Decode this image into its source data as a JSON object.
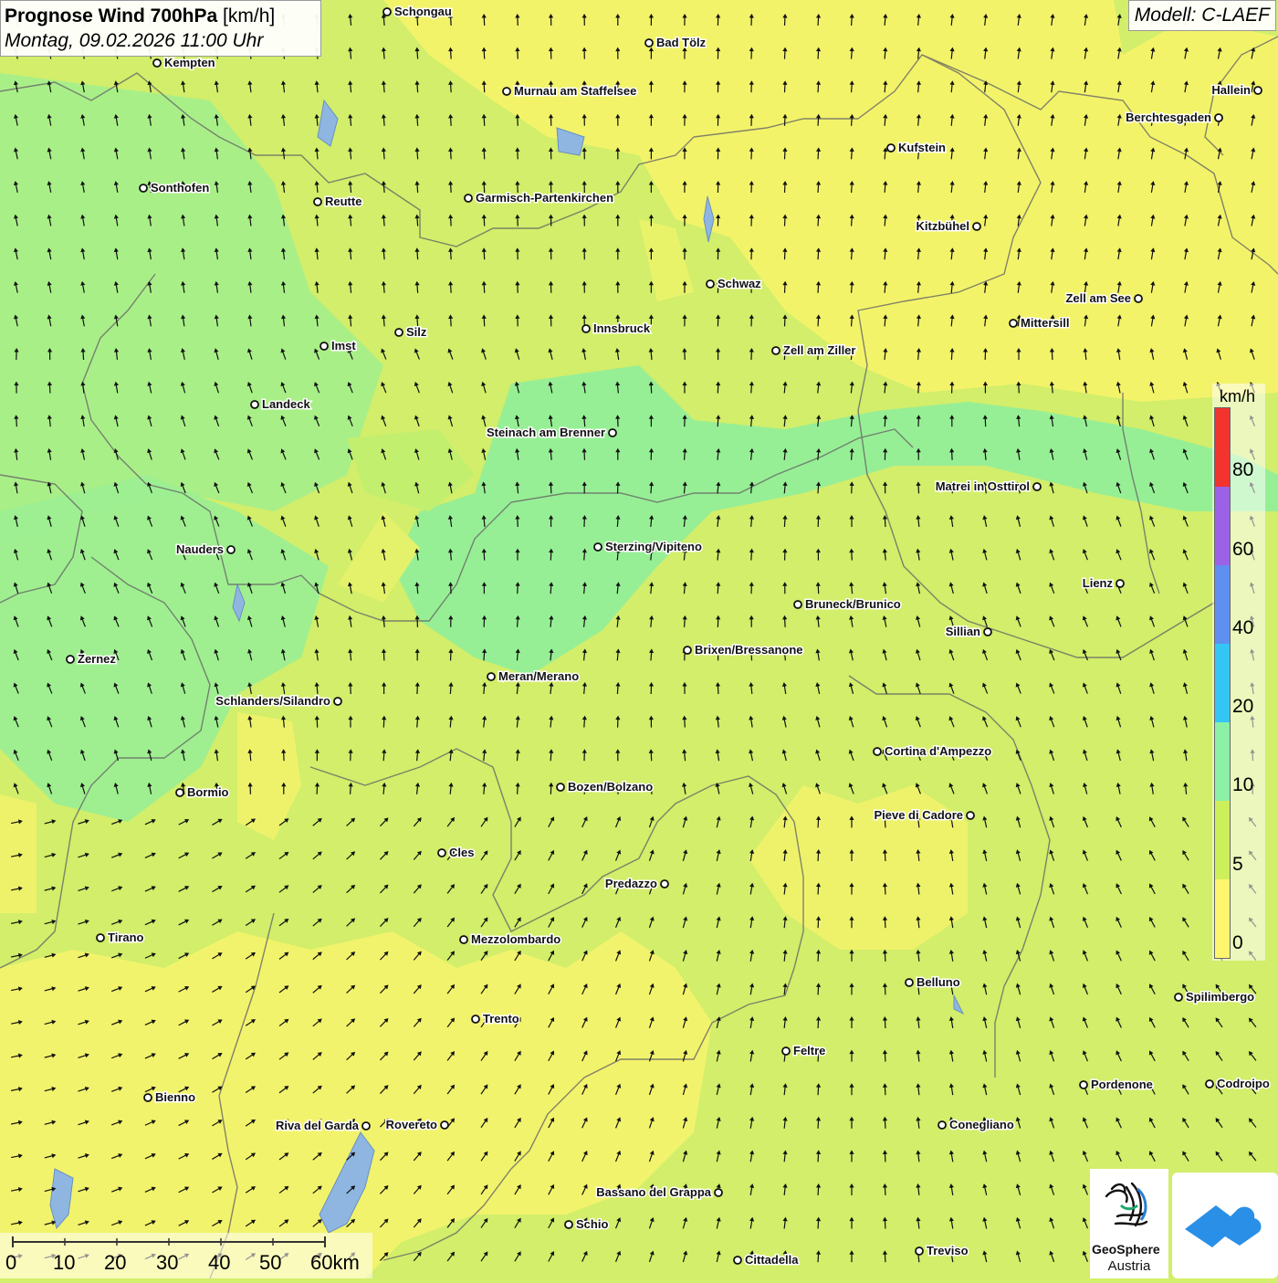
{
  "header": {
    "title_bold": "Prognose Wind 700hPa",
    "title_unit": "[km/h]",
    "datetime": "Montag, 09.02.2026 11:00 Uhr"
  },
  "model": {
    "label": "Modell: C-LAEF"
  },
  "legend": {
    "unit": "km/h",
    "levels": [
      {
        "label": "80",
        "color": "#f2332e"
      },
      {
        "label": "60",
        "color": "#9b62e8"
      },
      {
        "label": "40",
        "color": "#5f8ff0"
      },
      {
        "label": "20",
        "color": "#33c6f5"
      },
      {
        "label": "10",
        "color": "#8cf0a6"
      },
      {
        "label": "5",
        "color": "#cdf05a"
      },
      {
        "label": "0",
        "color": "#fff56e"
      }
    ]
  },
  "scalebar": {
    "labels": [
      "0",
      "10",
      "20",
      "30",
      "40",
      "50",
      "60km"
    ]
  },
  "logos": {
    "geosphere_line1": "GeoSphere",
    "geosphere_line2": "Austria"
  },
  "cities": [
    {
      "name": "Schongau"
    },
    {
      "name": "Bad Tölz"
    },
    {
      "name": "Kempten"
    },
    {
      "name": "Murnau am Staffelsee"
    },
    {
      "name": "Hallein"
    },
    {
      "name": "Berchtesgaden"
    },
    {
      "name": "Kufstein"
    },
    {
      "name": "Sonthofen"
    },
    {
      "name": "Reutte"
    },
    {
      "name": "Garmisch-Partenkirchen"
    },
    {
      "name": "Kitzbühel"
    },
    {
      "name": "Schwaz"
    },
    {
      "name": "Zell am See"
    },
    {
      "name": "Mittersill"
    },
    {
      "name": "Silz"
    },
    {
      "name": "Innsbruck"
    },
    {
      "name": "Imst"
    },
    {
      "name": "Zell am Ziller"
    },
    {
      "name": "Landeck"
    },
    {
      "name": "Steinach am Brenner"
    },
    {
      "name": "Matrei in Osttirol"
    },
    {
      "name": "Nauders"
    },
    {
      "name": "Sterzing/Vipiteno"
    },
    {
      "name": "Lienz"
    },
    {
      "name": "Bruneck/Brunico"
    },
    {
      "name": "Sillian"
    },
    {
      "name": "Zernez"
    },
    {
      "name": "Brixen/Bressanone"
    },
    {
      "name": "Meran/Merano"
    },
    {
      "name": "Schlanders/Silandro"
    },
    {
      "name": "Cortina d'Ampezzo"
    },
    {
      "name": "Bozen/Bolzano"
    },
    {
      "name": "Bormio"
    },
    {
      "name": "Pieve di Cadore"
    },
    {
      "name": "Cles"
    },
    {
      "name": "Predazzo"
    },
    {
      "name": "Tirano"
    },
    {
      "name": "Mezzolombardo"
    },
    {
      "name": "Belluno"
    },
    {
      "name": "Spilimbergo"
    },
    {
      "name": "Trento"
    },
    {
      "name": "Feltre"
    },
    {
      "name": "Bienno"
    },
    {
      "name": "Pordenone"
    },
    {
      "name": "Codroipo"
    },
    {
      "name": "Riva del Garda"
    },
    {
      "name": "Rovereto"
    },
    {
      "name": "Conegliano"
    },
    {
      "name": "Bassano del Grappa"
    },
    {
      "name": "Schio"
    },
    {
      "name": "Treviso"
    },
    {
      "name": "Cittadella"
    }
  ]
}
